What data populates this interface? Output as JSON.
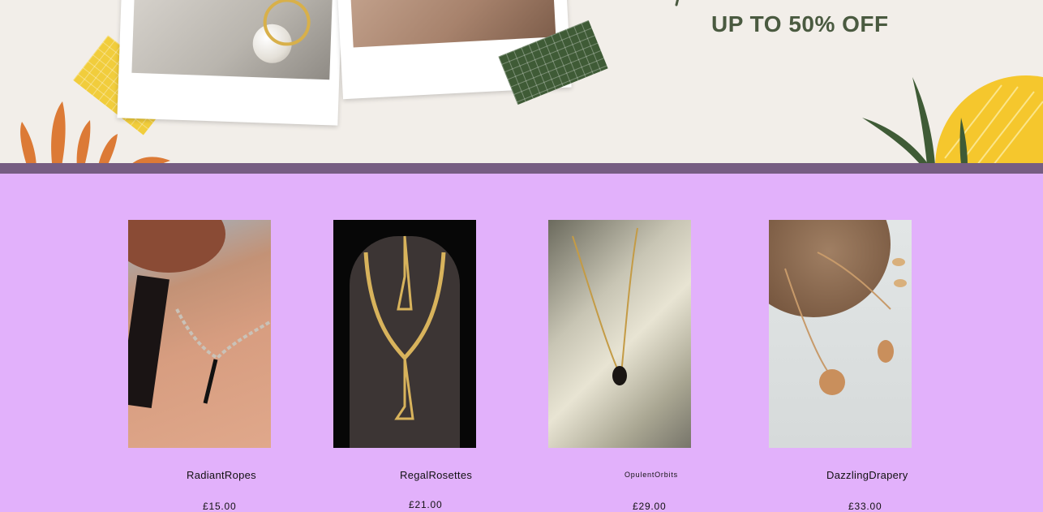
{
  "hero": {
    "promo_text": "UP TO 50% OFF",
    "colors": {
      "background": "#f2eee9",
      "accent_green": "#4a5a40",
      "tape_yellow": "#f1cd3c",
      "tape_green": "#3f5b36",
      "leaf_orange": "#dc7a36",
      "sun_yellow": "#f5c72d"
    }
  },
  "divider": {
    "color": "#765d82"
  },
  "products": {
    "background": "#e2b1fb",
    "items": [
      {
        "name": "RadiantRopes",
        "price": "£15.00",
        "image": "model-wearing-gold-chain-necklace"
      },
      {
        "name": "RegalRosettes",
        "price": "£21.00",
        "image": "gold-necklace-on-black-bust"
      },
      {
        "name": "OpulentOrbits",
        "price": "£29.00",
        "image": "gold-pendant-on-silk"
      },
      {
        "name": "DazzlingDrapery",
        "price": "£33.00",
        "image": "layered-coin-necklaces-on-wood"
      }
    ]
  }
}
